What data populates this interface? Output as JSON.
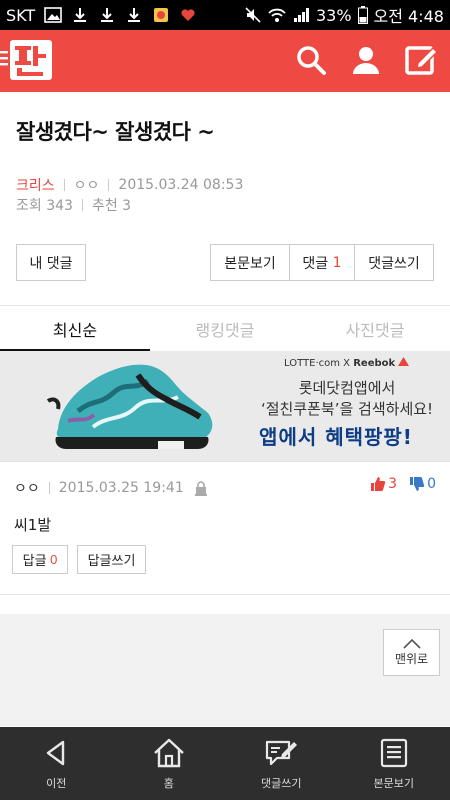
{
  "status_bar": {
    "carrier": "SKT",
    "battery": "33%",
    "time": "오전 4:48"
  },
  "post": {
    "title": "잘생겼다~ 잘생겼다 ~",
    "author": "크리스",
    "author_sub": "ㅇㅇ",
    "date": "2015.03.24 08:53",
    "views": "조회 343",
    "likes": "추천 3"
  },
  "actions": {
    "my_comments": "내 댓글",
    "view_article": "본문보기",
    "comments_label": "댓글",
    "comments_count": "1",
    "write_comment": "댓글쓰기"
  },
  "tabs": [
    "최신순",
    "랭킹댓글",
    "사진댓글"
  ],
  "ad": {
    "brand_left": "LOTTE·com",
    "brand_x": "X",
    "brand_right": "Reebok",
    "line1": "롯데닷컴앱에서",
    "line2": "‘절친쿠폰북’을 검색하세요!",
    "line3": "앱에서 혜택팡팡!"
  },
  "comment": {
    "nickname": "ㅇㅇ",
    "date": "2015.03.25 19:41",
    "upvotes": "3",
    "downvotes": "0",
    "text": "씨1발",
    "reply_label": "답글",
    "reply_count": "0",
    "write_reply": "답글쓰기"
  },
  "to_top": "맨위로",
  "bottom_nav": [
    "이전",
    "홈",
    "댓글쓰기",
    "본문보기"
  ],
  "colors": {
    "brand": "#ee4a43",
    "accent_red": "#e8453c",
    "accent_blue": "#3a79c8",
    "nav_bg": "#2e2e2e"
  }
}
